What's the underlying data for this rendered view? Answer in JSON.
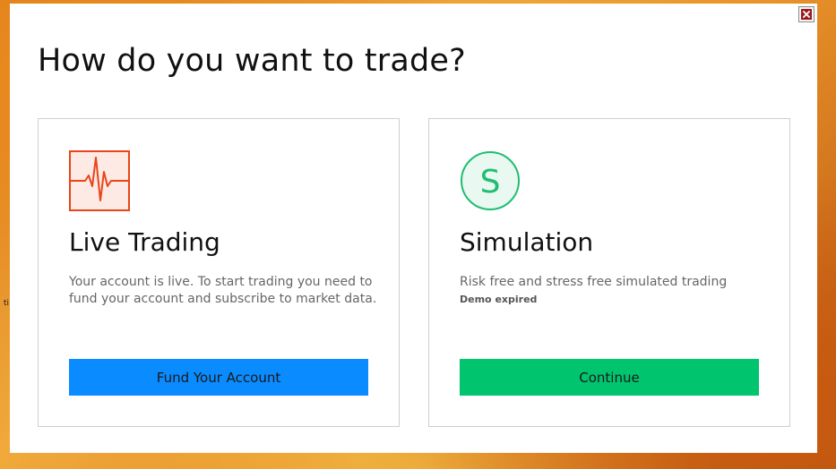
{
  "background": {
    "glyph": "ti"
  },
  "dialog": {
    "title": "How do you want to trade?",
    "close_icon": "close-icon"
  },
  "options": {
    "live": {
      "icon": "pulse-chart-icon",
      "title": "Live Trading",
      "description": "Your account is live. To start trading you need to fund your account and subscribe to market data.",
      "button_label": "Fund Your Account",
      "accent_color": "#e8461a",
      "button_color": "#0a8bff"
    },
    "simulation": {
      "icon": "simulation-s-icon",
      "icon_letter": "S",
      "title": "Simulation",
      "description": "Risk free and stress free simulated trading",
      "status": "Demo expired",
      "button_label": "Continue",
      "accent_color": "#1fbe72",
      "button_color": "#00c46e"
    }
  }
}
